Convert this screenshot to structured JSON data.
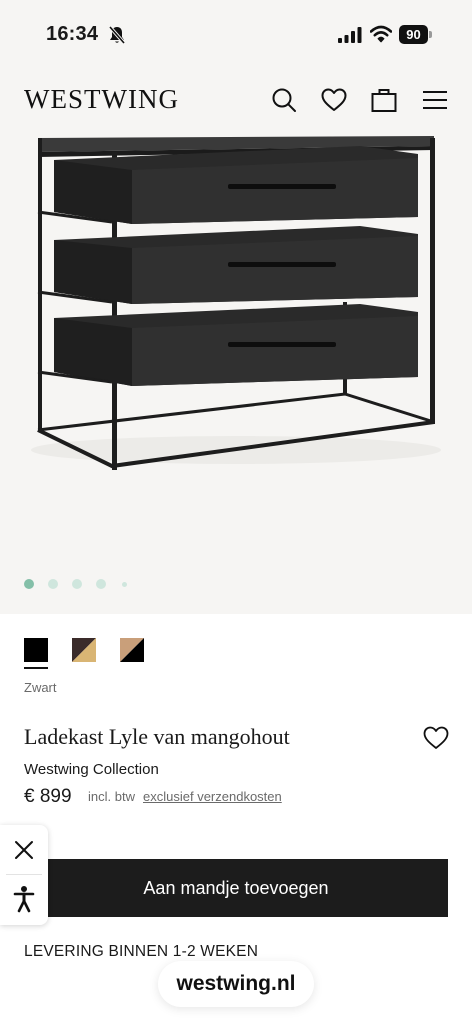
{
  "status_bar": {
    "time": "16:34",
    "battery": "90",
    "icons": [
      "bell-slash-icon",
      "cellular-signal-icon",
      "wifi-icon",
      "battery-icon"
    ]
  },
  "header": {
    "logo": "WESTWING",
    "icons": [
      "search-icon",
      "heart-icon",
      "shopping-bag-icon",
      "hamburger-menu-icon"
    ]
  },
  "gallery": {
    "image": "black metal and mango wood chest of drawers",
    "slide_count": 5,
    "active_slide": 1
  },
  "swatches": {
    "options": [
      {
        "name": "black",
        "colors": [
          "#000000"
        ]
      },
      {
        "name": "dark-brown-gold",
        "colors": [
          "#3a2b2a",
          "#d9b574"
        ]
      },
      {
        "name": "tan-black",
        "colors": [
          "#c99f7a",
          "#000000"
        ]
      }
    ],
    "selected_label": "Zwart"
  },
  "product": {
    "title": "Ladekast Lyle van mangohout",
    "brand": "Westwing Collection",
    "price": "€ 899",
    "vat_note": "incl. btw",
    "shipping_link": "exclusief verzendkosten"
  },
  "cart": {
    "button_label": "Aan mandje toevoegen"
  },
  "delivery": {
    "text": "LEVERING BINNEN 1-2 WEKEN"
  },
  "browser": {
    "domain": "westwing.nl"
  },
  "accessibility_widget": {
    "icons": [
      "close-icon",
      "accessibility-person-icon"
    ]
  },
  "colors": {
    "background": "#f6f5f3",
    "button": "#1c1c1c",
    "dot_active": "#84bfa8",
    "dot_inactive": "#cfe6dd"
  }
}
